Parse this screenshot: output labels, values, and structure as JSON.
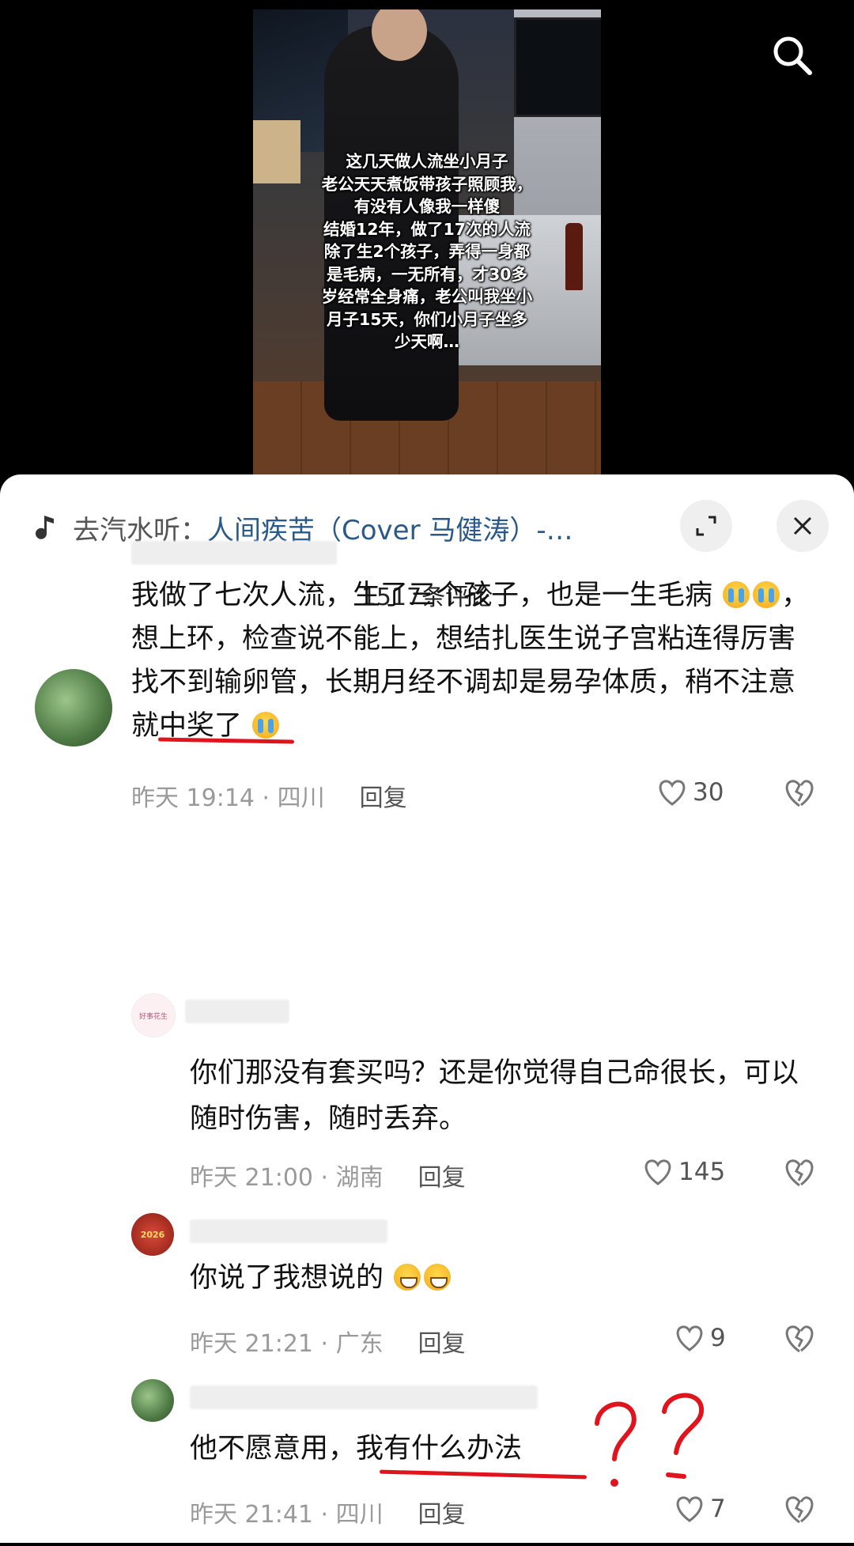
{
  "video": {
    "caption": "这几天做人流坐小月子\n老公天天煮饭带孩子照顾我，\n有没有人像我一样傻\n结婚12年，做了17次的人流\n除了生2个孩子，弄得一身都\n是毛病，一无所有，才30多\n岁经常全身痛，老公叫我坐小\n月子15天，你们小月子坐多\n少天啊…"
  },
  "music": {
    "prefix": "去汽水听：",
    "title": "人间疾苦（Cover 马健涛）-…"
  },
  "comments_header": {
    "count_label": "1517条评论"
  },
  "comments": [
    {
      "text_a": "我做了七次人流，生了三个孩子，也是一生毛病",
      "text_b": "，想上环，检查说不能上，想结扎医生说子宫粘连得厉害找不到输卵管，长期月经不调却是",
      "text_highlight": "易孕体质",
      "text_c": "，稍不注意就中奖了",
      "time": "昨天 19:14 · 四川",
      "reply_label": "回复",
      "likes": "30"
    },
    {
      "text": "你们那没有套买吗？还是你觉得自己命很长，可以随时伤害，随时丢弃。",
      "time": "昨天 21:00 · 湖南",
      "reply_label": "回复",
      "likes": "145",
      "avatar_text": "好事花生"
    },
    {
      "text_a": "你说了我想说的",
      "time": "昨天 21:21 · 广东",
      "reply_label": "回复",
      "likes": "9",
      "avatar_text": "2026"
    },
    {
      "text_a": "他不愿意用，",
      "text_highlight": "我有什么办法",
      "time": "昨天 21:41 · 四川",
      "reply_label": "回复",
      "likes": "7"
    }
  ],
  "icons": [
    "search-icon",
    "music-note-icon",
    "expand-icon",
    "close-icon",
    "heart-icon",
    "dislike-heart-icon"
  ],
  "colors": {
    "link": "#2b5a88",
    "annotation": "#e0141d",
    "meta": "#9a9a9a"
  }
}
